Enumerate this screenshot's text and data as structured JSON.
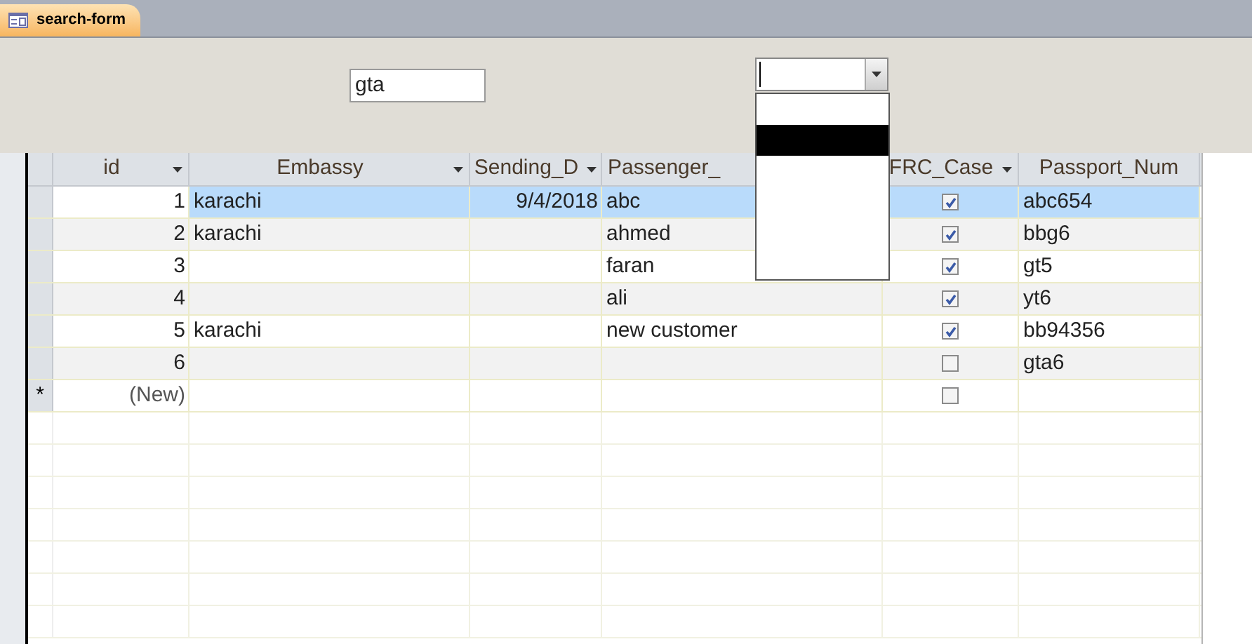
{
  "tab": {
    "title": "search-form",
    "selected": true
  },
  "search_field": {
    "value": "gta"
  },
  "combo": {
    "open": true,
    "options": [
      {
        "selected": false
      },
      {
        "selected": true
      },
      {
        "selected": false
      },
      {
        "selected": false
      },
      {
        "selected": false
      },
      {
        "selected": false
      }
    ]
  },
  "table": {
    "columns": [
      {
        "label": "id",
        "has_menu": true,
        "kind": "number"
      },
      {
        "label": "Embassy",
        "has_menu": true,
        "kind": "text"
      },
      {
        "label": "Sending_D",
        "has_menu": true,
        "kind": "date"
      },
      {
        "label": "Passenger_",
        "has_menu": false,
        "kind": "text"
      },
      {
        "label": "FRC_Case",
        "has_menu": true,
        "kind": "check"
      },
      {
        "label": "Passport_Num",
        "has_menu": false,
        "kind": "text"
      }
    ],
    "rows": [
      {
        "selected": true,
        "cells": [
          "1",
          "karachi",
          "9/4/2018",
          "abc",
          true,
          "abc654"
        ]
      },
      {
        "selected": false,
        "cells": [
          "2",
          "karachi",
          "",
          "ahmed",
          true,
          "bbg6"
        ]
      },
      {
        "selected": false,
        "cells": [
          "3",
          "",
          "",
          "faran",
          true,
          "gt5"
        ]
      },
      {
        "selected": false,
        "cells": [
          "4",
          "",
          "",
          "ali",
          true,
          "yt6"
        ]
      },
      {
        "selected": false,
        "cells": [
          "5",
          "karachi",
          "",
          "new customer",
          true,
          "bb94356"
        ]
      },
      {
        "selected": false,
        "cells": [
          "6",
          "",
          "",
          "",
          false,
          "gta6"
        ]
      },
      {
        "selected": false,
        "marker": "*",
        "cells": [
          "(New)",
          "",
          "",
          "",
          false,
          ""
        ]
      }
    ]
  }
}
